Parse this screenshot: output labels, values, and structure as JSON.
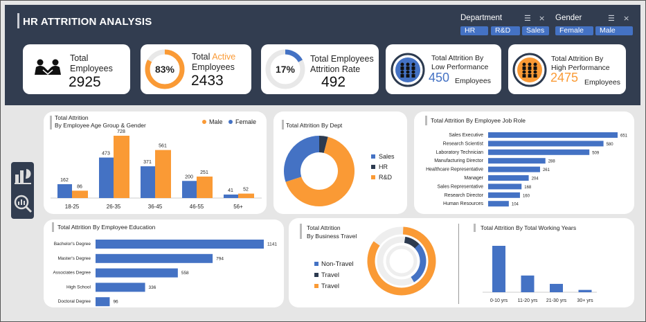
{
  "header": {
    "title": "HR ATTRITION ANALYSIS"
  },
  "slicers": {
    "department": {
      "title": "Department",
      "options": [
        "HR",
        "R&D",
        "Sales"
      ]
    },
    "gender": {
      "title": "Gender",
      "options": [
        "Female",
        "Male"
      ]
    }
  },
  "kpis": {
    "total_employees": {
      "label1": "Total",
      "label2": "Employees",
      "value": "2925",
      "icon": "handshake-people-icon"
    },
    "active": {
      "label_pre": "Total ",
      "label_active": "Active",
      "label2": "Employees",
      "value": "2433",
      "pct": "83%",
      "pct_value": 0.83
    },
    "attrition_rate": {
      "label1": "Total Employees",
      "label2": "Attrition Rate",
      "value": "492",
      "pct": "17%",
      "pct_value": 0.17
    },
    "low_perf": {
      "label1": "Total Attrition By",
      "label2": "Low Performance",
      "value": "450",
      "unit": "Employees",
      "icon": "group-icon"
    },
    "high_perf": {
      "label1": "Total Attrition By",
      "label2": "High Performance",
      "value": "2475",
      "unit": "Employees",
      "icon": "group-icon"
    }
  },
  "colors": {
    "blue": "#4472c4",
    "orange": "#fa9a35",
    "navy": "#323d50",
    "dark": "#2c3a4f"
  },
  "chart_data": [
    {
      "type": "bar",
      "title": "Total Attrition",
      "subtitle": "By Employee Age Group & Gender",
      "categories": [
        "18-25",
        "26-35",
        "36-45",
        "46-55",
        "56+"
      ],
      "series": [
        {
          "name": "Male",
          "values": [
            86,
            728,
            561,
            251,
            52
          ]
        },
        {
          "name": "Female",
          "values": [
            162,
            473,
            371,
            200,
            41
          ]
        }
      ],
      "legend": "top-right"
    },
    {
      "type": "pie",
      "title": "Total Attrition",
      "subtitle": "By Dept",
      "categories": [
        "Sales",
        "HR",
        "R&D"
      ],
      "values": [
        0.3,
        0.04,
        0.66
      ]
    },
    {
      "type": "bar",
      "title": "Total Attrition",
      "subtitle": "By Employee Job Role",
      "categories": [
        "Sales Executive",
        "Research Scientist",
        "Laboratory Technician",
        "Manufacturing Director",
        "Healthcare Representative",
        "Manager",
        "Sales Representative",
        "Research Director",
        "Human Resources"
      ],
      "values": [
        651,
        580,
        509,
        288,
        261,
        204,
        168,
        160,
        104
      ]
    },
    {
      "type": "bar",
      "title": "Total Attrition",
      "subtitle": "By Employee Education",
      "categories": [
        "Bachelor's Degree",
        "Master's Degree",
        "Associates Degree",
        "High School",
        "Doctoral Degree"
      ],
      "values": [
        1141,
        794,
        558,
        336,
        96
      ]
    },
    {
      "type": "pie",
      "title": "Total Attrition",
      "subtitle": "By Business Travel",
      "categories": [
        "Non-Travel",
        "Travel",
        "Travel"
      ],
      "values": [
        0.12,
        0.04,
        0.84
      ]
    },
    {
      "type": "bar",
      "title": "Total Attrition",
      "subtitle": "By Total Working Years",
      "categories": [
        "0-10 yrs",
        "11-20 yrs",
        "21-30 yrs",
        "30+ yrs"
      ],
      "values": [
        100,
        36,
        18,
        5
      ]
    }
  ]
}
